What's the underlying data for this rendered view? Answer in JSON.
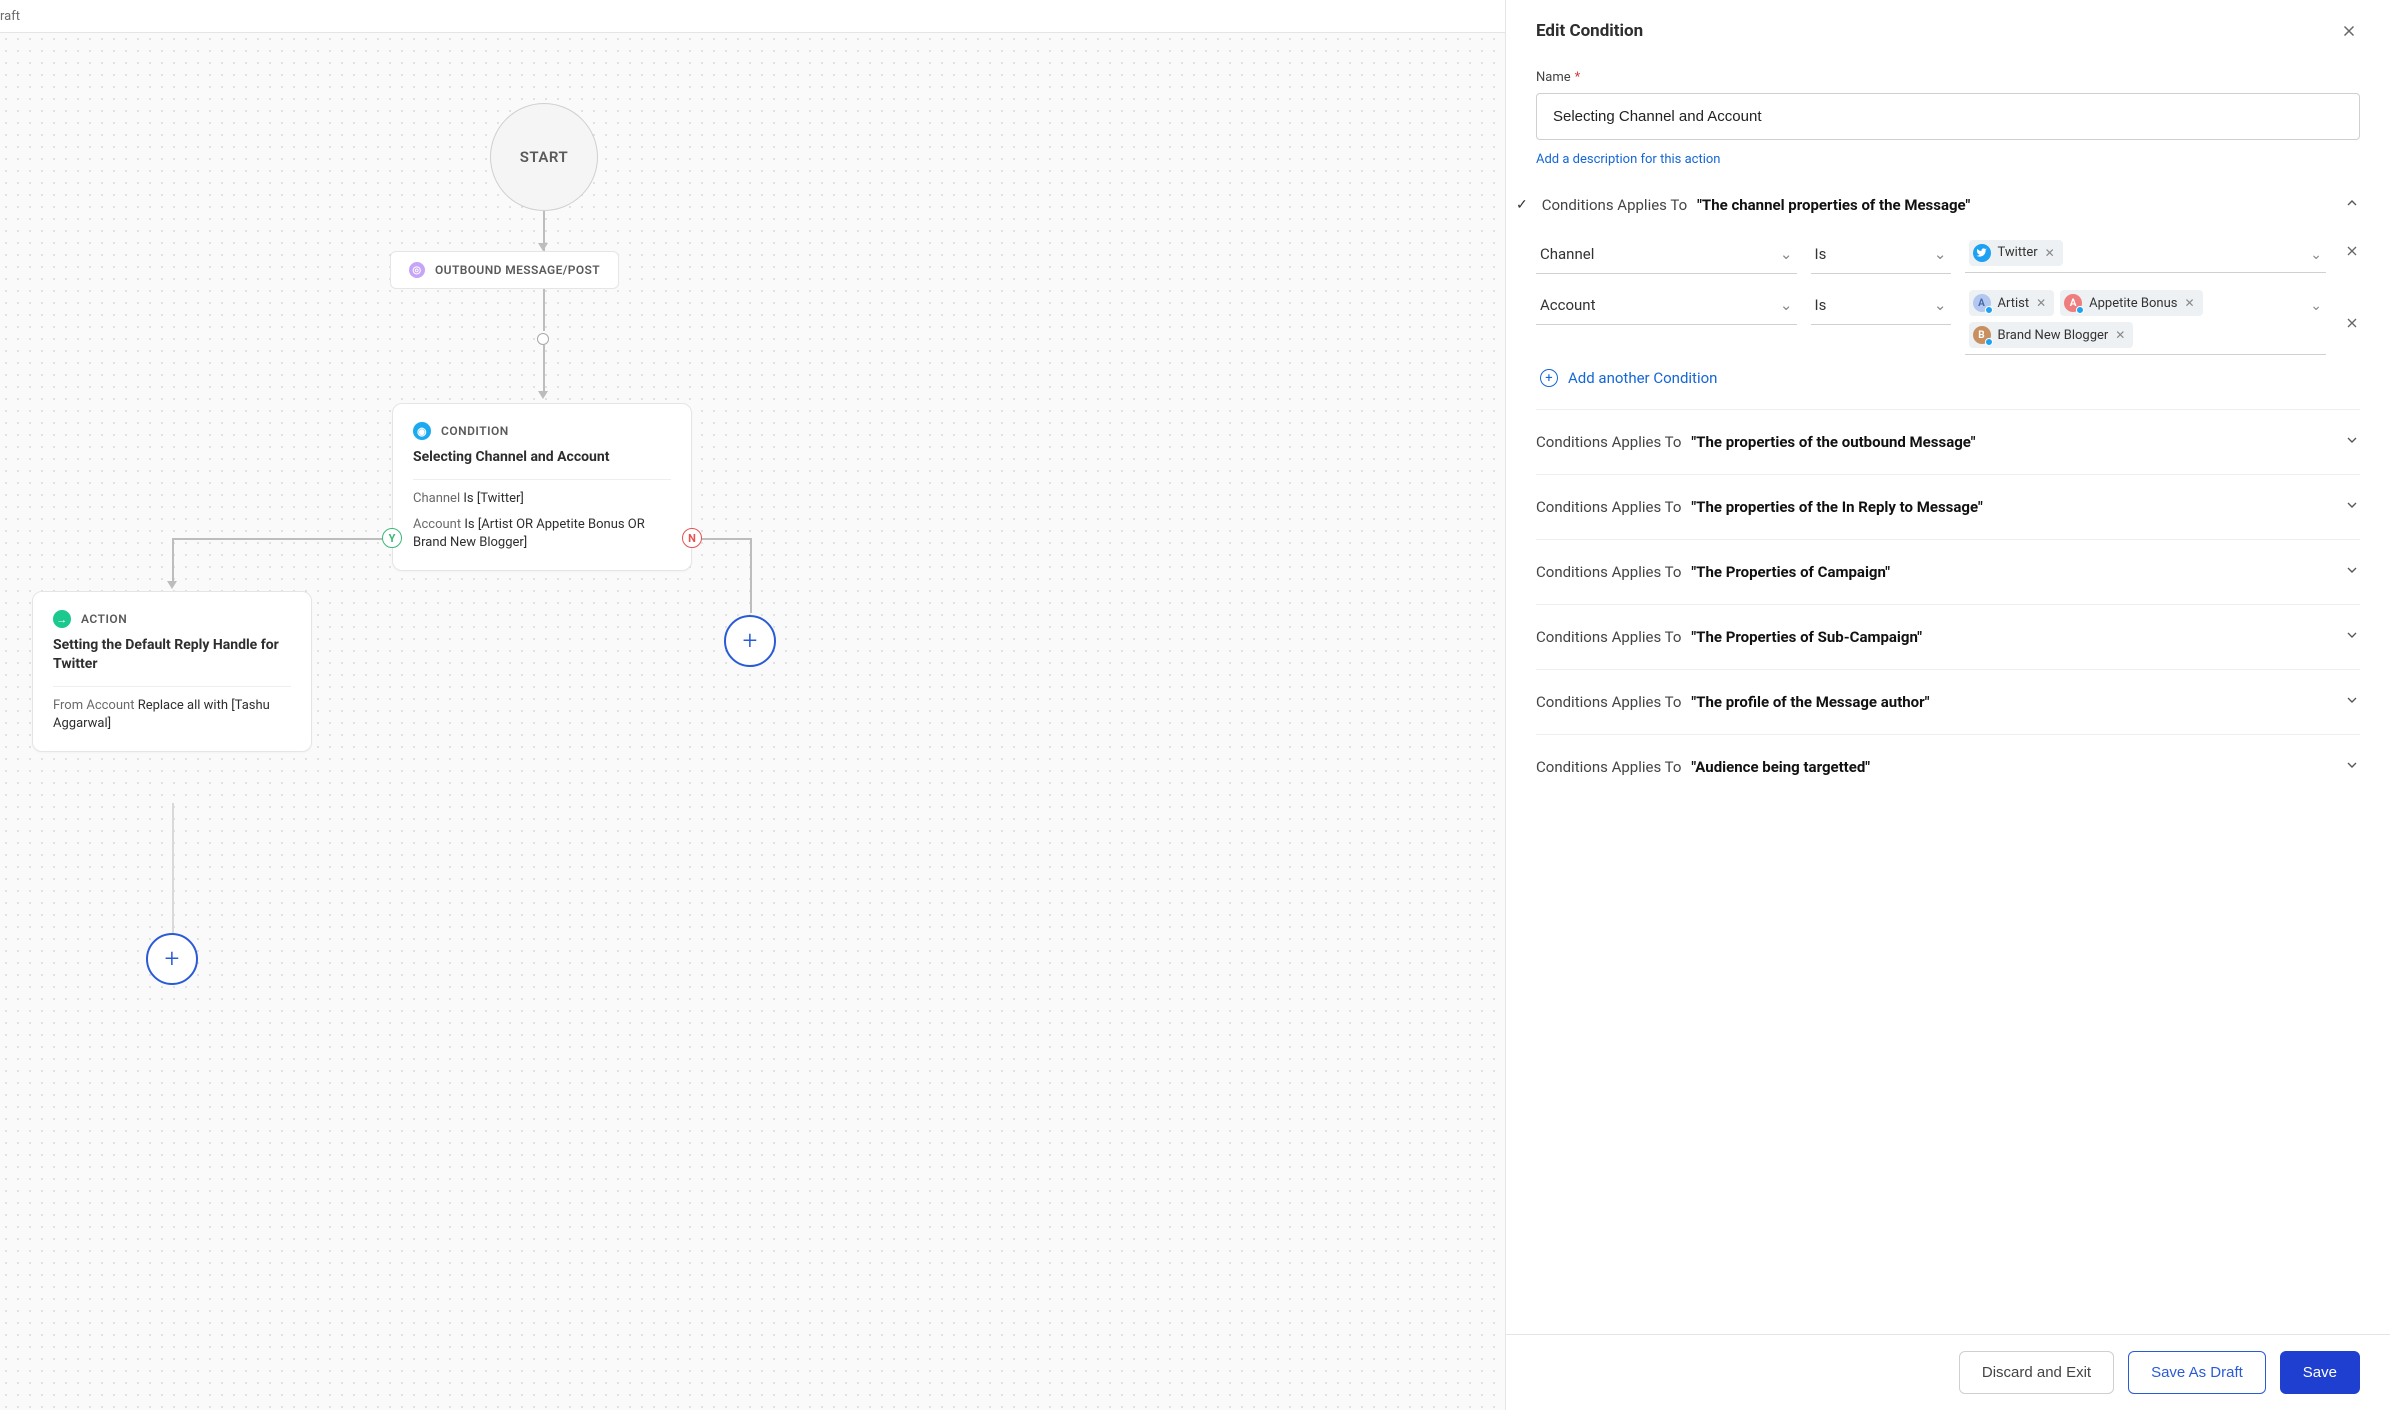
{
  "breadcrumb": "raft",
  "canvas": {
    "start_label": "START",
    "outbound_label": "OUTBOUND MESSAGE/POST",
    "condition_node": {
      "type_label": "CONDITION",
      "title": "Selecting Channel and Account",
      "line1_field": "Channel",
      "line1_value": "Is [Twitter]",
      "line2_field": "Account",
      "line2_value": "Is [Artist OR Appetite Bonus OR Brand New Blogger]"
    },
    "action_node": {
      "type_label": "ACTION",
      "title": "Setting the Default Reply Handle for Twitter",
      "line1_field": "From Account",
      "line1_value": "Replace all with [Tashu Aggarwal]"
    },
    "y_label": "Y",
    "n_label": "N"
  },
  "panel": {
    "title": "Edit Condition",
    "name_label": "Name",
    "name_value": "Selecting Channel and Account",
    "add_description": "Add a description for this action",
    "section_prefix": "Conditions Applies To",
    "expanded_section": {
      "title": "\"The channel properties of the Message\"",
      "row1": {
        "field": "Channel",
        "operator": "Is",
        "chips": [
          {
            "label": "Twitter",
            "color": "#1da1f2"
          }
        ]
      },
      "row2": {
        "field": "Account",
        "operator": "Is",
        "chips": [
          {
            "label": "Artist",
            "color": "#b3c8f0",
            "initial": "A"
          },
          {
            "label": "Appetite Bonus",
            "color": "#f07d7d",
            "initial": "A"
          },
          {
            "label": "Brand New Blogger",
            "color": "#c89060",
            "initial": "B"
          }
        ]
      }
    },
    "add_condition": "Add another Condition",
    "collapsed_sections": [
      "\"The properties of the outbound Message\"",
      "\"The properties of the In Reply to Message\"",
      "\"The Properties of Campaign\"",
      "\"The Properties of Sub-Campaign\"",
      "\"The profile of the Message author\"",
      "\"Audience being targetted\""
    ],
    "buttons": {
      "discard": "Discard and Exit",
      "draft": "Save As Draft",
      "save": "Save"
    }
  }
}
